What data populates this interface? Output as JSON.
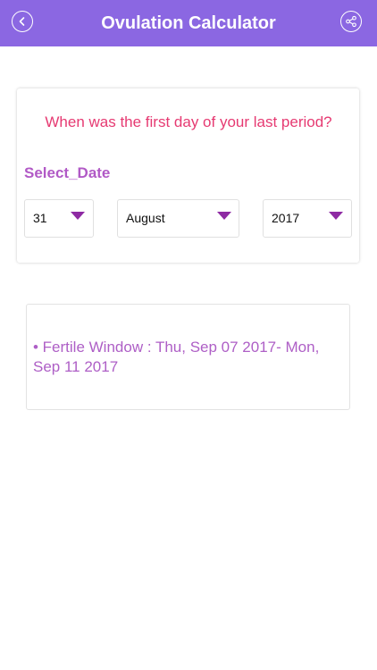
{
  "header": {
    "title": "Ovulation Calculator",
    "back_icon": "chevron-left-icon",
    "share_icon": "share-icon",
    "background_color": "#8b67e2"
  },
  "form": {
    "question": "When was the first day of your last period?",
    "select_label": "Select_Date",
    "day": {
      "value": "31"
    },
    "month": {
      "value": "August"
    },
    "year": {
      "value": "2017"
    },
    "caret_icon": "caret-down-icon",
    "caret_color": "#8e2aa3",
    "question_color": "#e63a72",
    "label_color": "#b159c6"
  },
  "result": {
    "text": "• Fertile Window : Thu, Sep 07 2017- Mon, Sep 11 2017",
    "text_color": "#ae5fc6"
  }
}
